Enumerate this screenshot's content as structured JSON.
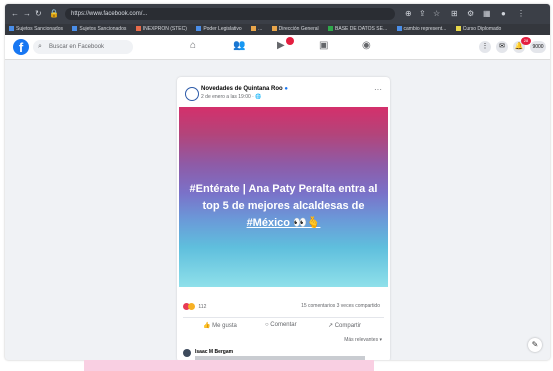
{
  "browser": {
    "url": "https://www.facebook.com/...",
    "bookmarks": [
      "Sujetos Sancionados",
      "Sujetos Sancionados",
      "INEXPRON (STEC)",
      "Poder Legislativo",
      "...",
      "Dirección General",
      "BASE DE DATOS SE...",
      "cambio represent...",
      "Curso Diplomado"
    ]
  },
  "fb": {
    "search_placeholder": "Buscar en Facebook",
    "notification_count": "28",
    "profile_label": "9000"
  },
  "post": {
    "page_name": "Novedades de Quintana Roo",
    "time": "2 de enero a las 19:00 · 🌐",
    "headline_line1": "#Entérate | Ana Paty Peralta entra al",
    "headline_line2": "top 5 de mejores alcaldesas de",
    "headline_line3": "#México 👀🫰",
    "reaction_count": "112",
    "comments_shares": "15 comentarios  3 veces compartido",
    "action_like": "Me gusta",
    "action_comment": "Comentar",
    "action_share": "Compartir",
    "relevant_label": "Más relevantes ▾",
    "comment_author": "Isaac M Bergam"
  }
}
